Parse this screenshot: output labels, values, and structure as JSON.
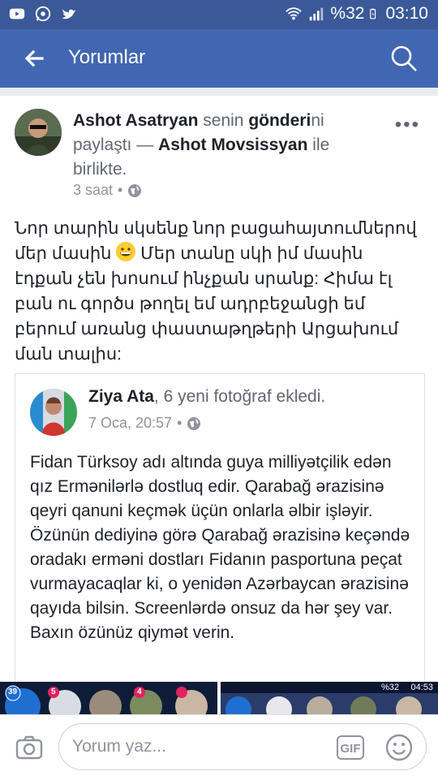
{
  "status_bar": {
    "battery": "%32",
    "time": "03:10",
    "left_icons": [
      "youtube-icon",
      "whatsapp-icon",
      "twitter-icon"
    ],
    "right_icons": [
      "wifi-icon",
      "signal-icon",
      "battery-icon"
    ]
  },
  "app_bar": {
    "title": "Yorumlar",
    "back_icon": "arrow-left-icon",
    "search_icon": "search-icon"
  },
  "post": {
    "author": "Ashot Asatryan",
    "text_1": " senin ",
    "shared_word": "gönderi",
    "text_2": "ni paylaştı — ",
    "with_name": "Ashot Movsissyan",
    "text_3": " ile birlikte.",
    "time": "3 saat",
    "dot": "•",
    "body_1": "Նոր տարին սկսենք նոր բացահայտումներով մեր մասին",
    "body_2": " Մեր տանը սկի իմ մասին էդքան չեն խոսում ինչքան սրանք: Հիմա էլ բան ու գործս թողել եմ ադրբեջանցի եմ բերում առանց փաստաթղթերի Արցախում ման տալիս:",
    "more": "•••"
  },
  "shared_post": {
    "author": "Ziya Ata",
    "action": ", 6 yeni fotoğraf ekledi.",
    "time": "7 Oca, 20:57",
    "dot": "•",
    "body": "Fidan Türksoy adı altında guya milliyətçilik edən qız Ermənilərlə dostluq edir. Qarabağ ərazisinə qeyri qanuni keçmək üçün onlarla əlbir işləyir. Özünün dediyinə görə Qarabağ ərazisinə keçəndə oradakı erməni dostları Fidanın pasportuna peçat vurmayacaqlar ki, o yenidən Azərbaycan ərazisinə qayıda bilsin. Screenlərdə onsuz da hər şey var. Baxın özünüz qiymət verin."
  },
  "thumbnails": {
    "right_battery": "%32",
    "right_time": "04:53",
    "badge_a": "39",
    "badge_b": "5",
    "badge_c": "4"
  },
  "composer": {
    "placeholder": "Yorum yaz...",
    "gif_label": "GIF"
  },
  "colors": {
    "status_bar": "#3b5998",
    "app_bar": "#4267b2"
  }
}
